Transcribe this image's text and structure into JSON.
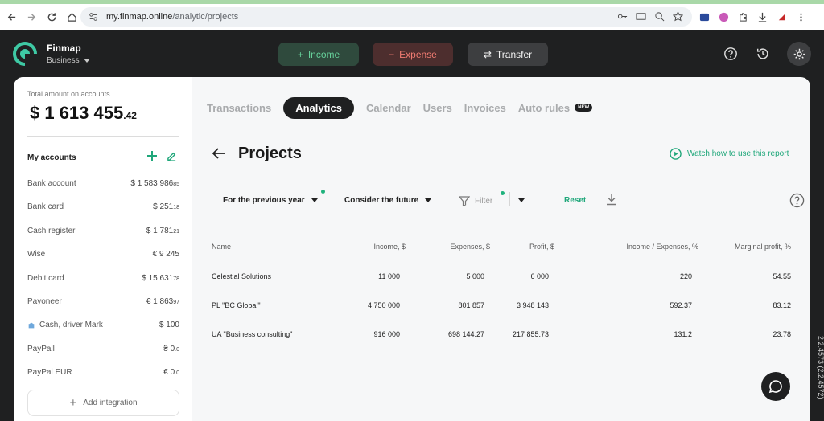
{
  "browser": {
    "url_host": "my.finmap.online",
    "url_path": "/analytic/projects"
  },
  "header": {
    "brand_name": "Finmap",
    "brand_type": "Business",
    "income_label": "Income",
    "expense_label": "Expense",
    "transfer_label": "Transfer"
  },
  "sidebar": {
    "total_label": "Total amount on accounts",
    "total_main": "$ 1 613 455",
    "total_cents": ".42",
    "accounts_title": "My accounts",
    "accounts": [
      {
        "name": "Bank account",
        "amount": "$ 1 583 986",
        "cents": "85"
      },
      {
        "name": "Bank card",
        "amount": "$ 251",
        "cents": "18"
      },
      {
        "name": "Cash register",
        "amount": "$ 1 781",
        "cents": "21"
      },
      {
        "name": "Wise",
        "amount": "€ 9 245",
        "cents": ""
      },
      {
        "name": "Debit card",
        "amount": "$ 15 631",
        "cents": "78"
      },
      {
        "name": "Payoneer",
        "amount": "€ 1 863",
        "cents": "97"
      },
      {
        "name": "Cash, driver Mark",
        "amount": "$ 100",
        "cents": ""
      },
      {
        "name": "PayPall",
        "amount": "₴ 0",
        "cents": ".0"
      },
      {
        "name": "PayPal EUR",
        "amount": "€ 0",
        "cents": ".0"
      }
    ],
    "add_integration": "Add integration"
  },
  "tabs": [
    {
      "label": "Transactions"
    },
    {
      "label": "Analytics"
    },
    {
      "label": "Calendar"
    },
    {
      "label": "Users"
    },
    {
      "label": "Invoices"
    },
    {
      "label": "Auto rules"
    }
  ],
  "tab_new_badge": "NEW",
  "page": {
    "title": "Projects",
    "watch_link": "Watch how to use this report"
  },
  "filters": {
    "period": "For the previous year",
    "future": "Consider the future",
    "filter": "Filter",
    "reset": "Reset"
  },
  "table": {
    "headers": [
      "Name",
      "Income, $",
      "Expenses, $",
      "Profit, $",
      "Income / Expenses, %",
      "Marginal profit, %"
    ],
    "rows": [
      [
        "Celestial Solutions",
        "11 000",
        "5 000",
        "6 000",
        "220",
        "54.55"
      ],
      [
        "PL \"BC Global\"",
        "4 750 000",
        "801 857",
        "3 948 143",
        "592.37",
        "83.12"
      ],
      [
        "UA \"Business consulting\"",
        "916 000",
        "698 144.27",
        "217 855.73",
        "131.2",
        "23.78"
      ]
    ]
  },
  "version": "2.2.4573 (2.2.4572)",
  "colors": {
    "accent_green": "#1fa77a",
    "income": "#66d09a",
    "expense": "#f07c72",
    "dark": "#1f2021"
  }
}
